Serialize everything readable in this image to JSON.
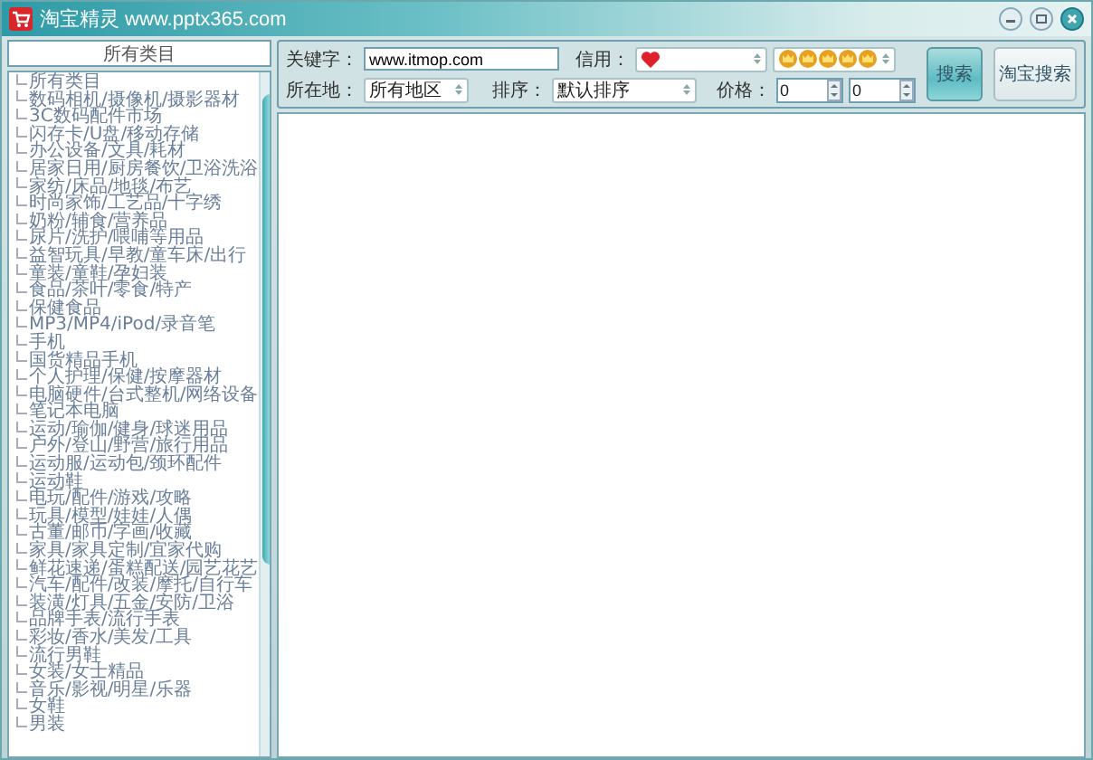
{
  "window": {
    "title": "淘宝精灵 www.pptx365.com"
  },
  "sidebar": {
    "header": "所有类目",
    "items": [
      "所有类目",
      "数码相机/摄像机/摄影器材",
      "3C数码配件市场",
      "闪存卡/U盘/移动存储",
      "办公设备/文具/耗材",
      "居家日用/厨房餐饮/卫浴洗浴",
      "家纺/床品/地毯/布艺",
      "时尚家饰/工艺品/十字绣",
      "奶粉/辅食/营养品",
      "尿片/洗护/喂哺等用品",
      "益智玩具/早教/童车床/出行",
      "童装/童鞋/孕妇装",
      "食品/茶叶/零食/特产",
      "保健食品",
      "MP3/MP4/iPod/录音笔",
      "手机",
      "国货精品手机",
      "个人护理/保健/按摩器材",
      "电脑硬件/台式整机/网络设备",
      "笔记本电脑",
      "运动/瑜伽/健身/球迷用品",
      "户外/登山/野营/旅行用品",
      "运动服/运动包/颈环配件",
      "运动鞋",
      "电玩/配件/游戏/攻略",
      "玩具/模型/娃娃/人偶",
      "古董/邮币/字画/收藏",
      "家具/家具定制/宜家代购",
      "鲜花速递/蛋糕配送/园艺花艺",
      "汽车/配件/改装/摩托/自行车",
      "装潢/灯具/五金/安防/卫浴",
      "品牌手表/流行手表",
      "彩妆/香水/美发/工具",
      "流行男鞋",
      "女装/女士精品",
      "音乐/影视/明星/乐器",
      "女鞋",
      "男装"
    ]
  },
  "search": {
    "keyword_label": "关键字：",
    "keyword_value": "www.itmop.com",
    "credit_label": "信用：",
    "location_label": "所在地：",
    "location_value": "所有地区",
    "sort_label": "排序：",
    "sort_value": "默认排序",
    "price_label": "价格：",
    "price_min": "0",
    "price_max": "0"
  },
  "buttons": [
    {
      "label": "搜索",
      "kind": "primary"
    },
    {
      "label": "淘宝搜索",
      "kind": "secondary"
    }
  ]
}
